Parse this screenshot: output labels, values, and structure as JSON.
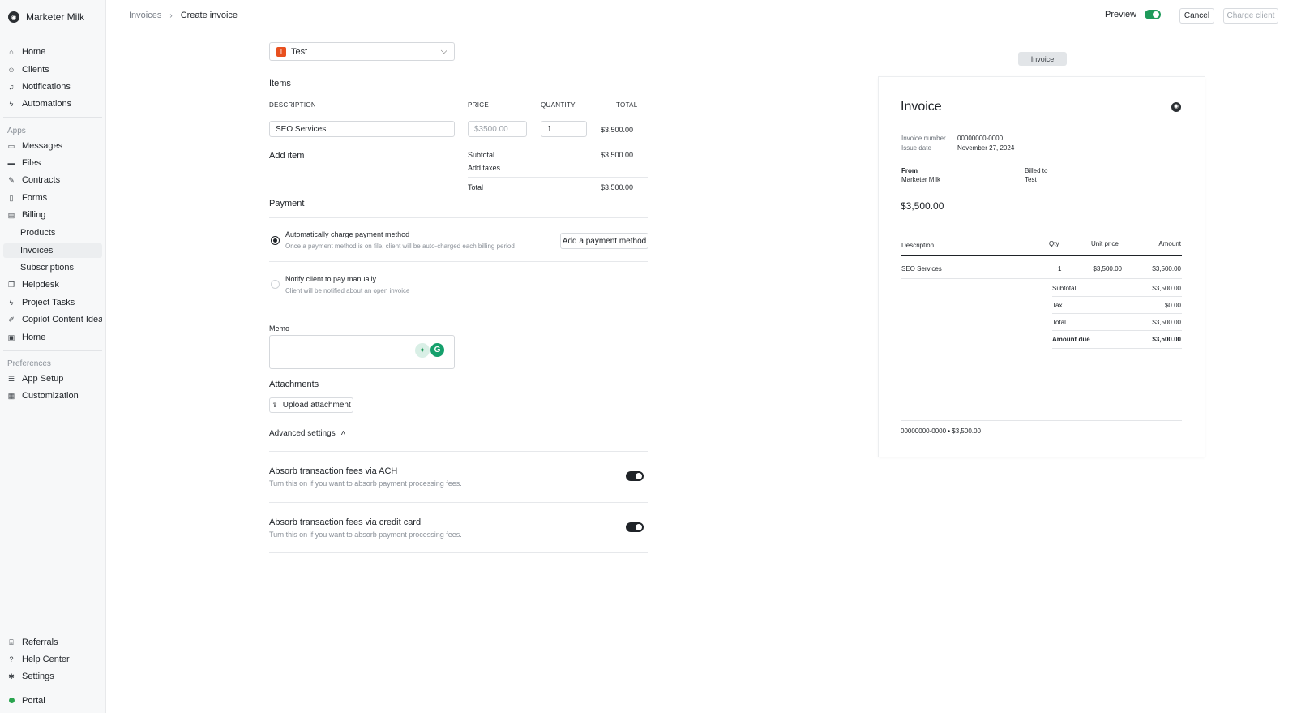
{
  "brand": {
    "name": "Marketer Milk"
  },
  "nav": {
    "main": [
      {
        "label": "Home"
      },
      {
        "label": "Clients"
      },
      {
        "label": "Notifications"
      },
      {
        "label": "Automations"
      }
    ],
    "apps_heading": "Apps",
    "apps": [
      {
        "label": "Messages"
      },
      {
        "label": "Files"
      },
      {
        "label": "Contracts"
      },
      {
        "label": "Forms"
      },
      {
        "label": "Billing"
      },
      {
        "label": "Products"
      },
      {
        "label": "Invoices"
      },
      {
        "label": "Subscriptions"
      },
      {
        "label": "Helpdesk"
      },
      {
        "label": "Project Tasks"
      },
      {
        "label": "Copilot Content Ideat..."
      },
      {
        "label": "Home"
      }
    ],
    "preferences_heading": "Preferences",
    "preferences": [
      {
        "label": "App Setup"
      },
      {
        "label": "Customization"
      }
    ],
    "footer": [
      {
        "label": "Referrals"
      },
      {
        "label": "Help Center"
      },
      {
        "label": "Settings"
      },
      {
        "label": "Portal"
      }
    ]
  },
  "header": {
    "breadcrumb": [
      "Invoices",
      "Create invoice"
    ],
    "preview_label": "Preview",
    "cancel": "Cancel",
    "charge": "Charge client"
  },
  "form": {
    "client": {
      "badge": "T",
      "name": "Test"
    },
    "items_heading": "Items",
    "columns": {
      "description": "DESCRIPTION",
      "price": "PRICE",
      "quantity": "QUANTITY",
      "total": "TOTAL"
    },
    "line_item": {
      "description": "SEO Services",
      "price_placeholder": "$3500.00",
      "quantity": "1",
      "total": "$3,500.00"
    },
    "add_item": "Add item",
    "subtotal_label": "Subtotal",
    "subtotal": "$3,500.00",
    "add_taxes": "Add taxes",
    "total_label": "Total",
    "total": "$3,500.00",
    "payment_heading": "Payment",
    "payment_auto": {
      "title": "Automatically charge payment method",
      "desc": "Once a payment method is on file, client will be auto-charged each billing period"
    },
    "add_payment_method": "Add a payment method",
    "payment_manual": {
      "title": "Notify client to pay manually",
      "desc": "Client will be notified about an open invoice"
    },
    "memo_label": "Memo",
    "attachments_label": "Attachments",
    "upload": "Upload attachment",
    "advanced": "Advanced settings",
    "ach": {
      "title": "Absorb transaction fees via ACH",
      "desc": "Turn this on if you want to absorb payment processing fees."
    },
    "cc": {
      "title": "Absorb transaction fees via credit card",
      "desc": "Turn this on if you want to absorb payment processing fees."
    }
  },
  "preview": {
    "chip": "Invoice",
    "title": "Invoice",
    "invoice_number_label": "Invoice number",
    "invoice_number": "00000000-0000",
    "issue_date_label": "Issue date",
    "issue_date": "November 27, 2024",
    "from_label": "From",
    "from": "Marketer Milk",
    "billed_label": "Billed to",
    "billed": "Test",
    "amount": "$3,500.00",
    "cols": {
      "description": "Description",
      "qty": "Qty",
      "unit": "Unit price",
      "amount": "Amount"
    },
    "row": {
      "description": "SEO Services",
      "qty": "1",
      "unit": "$3,500.00",
      "amount": "$3,500.00"
    },
    "subtotal_label": "Subtotal",
    "subtotal": "$3,500.00",
    "tax_label": "Tax",
    "tax": "$0.00",
    "total_label": "Total",
    "total": "$3,500.00",
    "due_label": "Amount due",
    "due": "$3,500.00",
    "footer": "00000000-0000 • $3,500.00"
  },
  "colors": {
    "accent_green": "#1e9a5a",
    "badge_orange": "#e8501f"
  }
}
